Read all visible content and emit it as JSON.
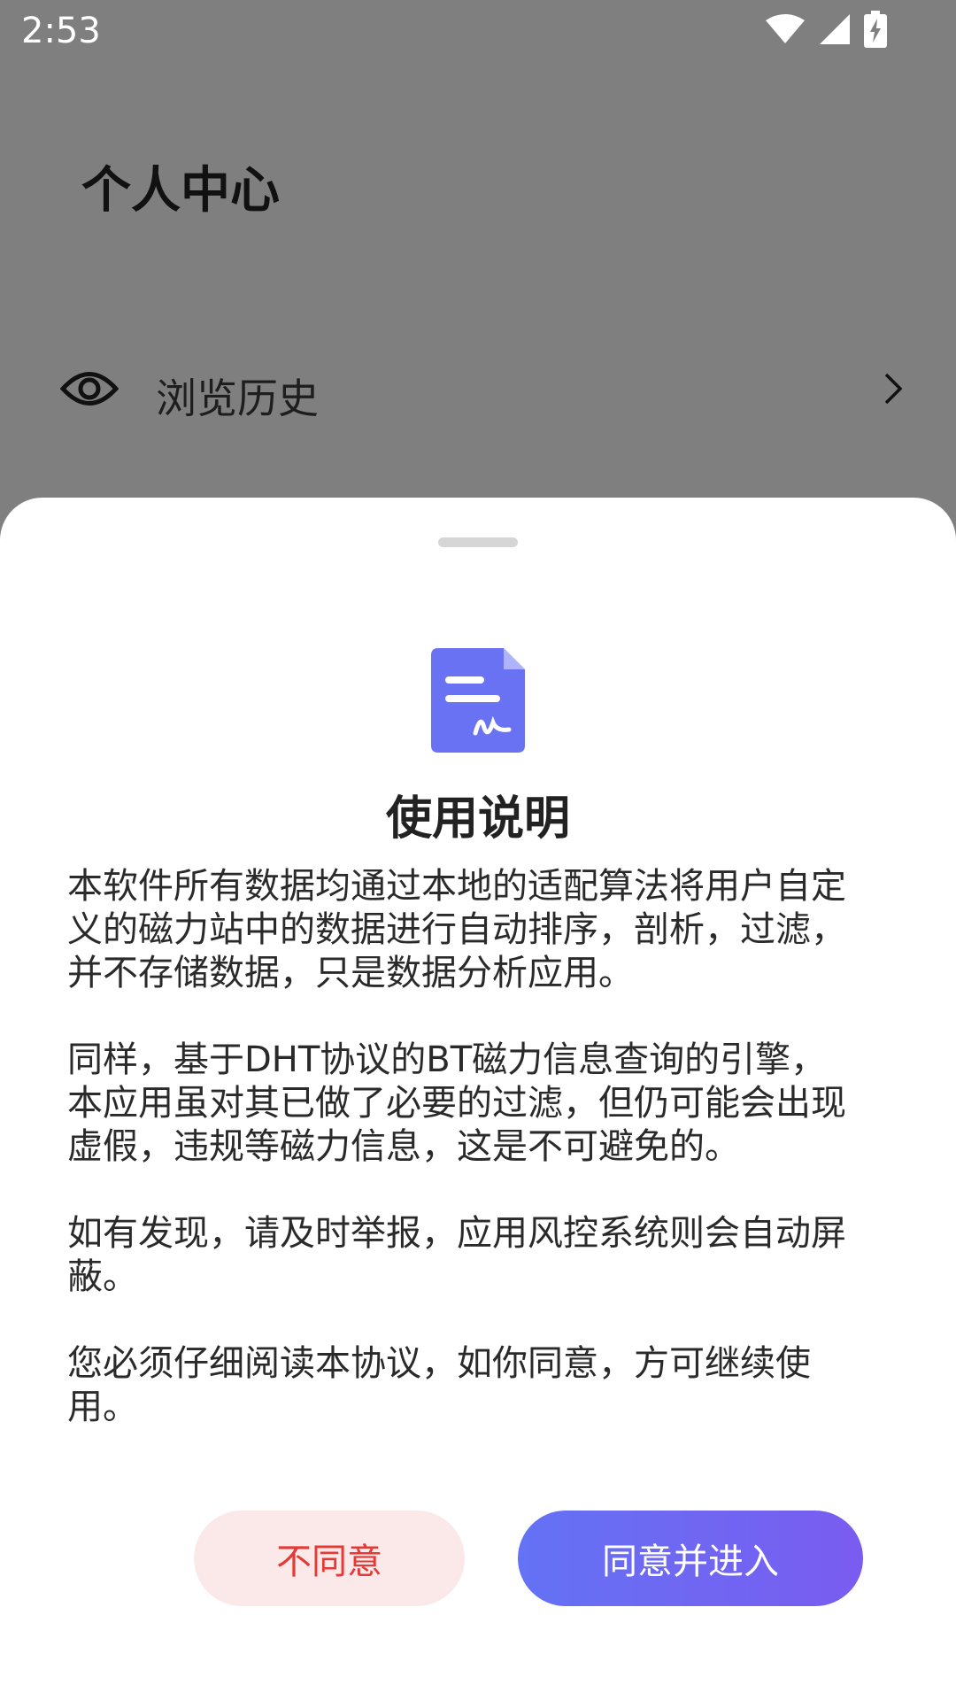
{
  "status_bar": {
    "time": "2:53",
    "icons": [
      "wifi-icon",
      "signal-icon",
      "battery-charging-icon"
    ]
  },
  "page": {
    "title": "个人中心",
    "items": [
      {
        "label": "浏览历史",
        "icon": "eye-icon",
        "trailing_icon": "chevron-right-icon"
      }
    ]
  },
  "dialog": {
    "icon": "document-signature-icon",
    "title": "使用说明",
    "paragraphs": [
      "本软件所有数据均通过本地的适配算法将用户自定\n义的磁力站中的数据进行自动排序，剖析，过滤，\n并不存储数据，只是数据分析应用。",
      "同样，基于DHT协议的BT磁力信息查询的引擎，\n本应用虽对其已做了必要的过滤，但仍可能会出现\n虚假，违规等磁力信息，这是不可避免的。",
      "如有发现，请及时举报，应用风控系统则会自动屏\n蔽。",
      "您必须仔细阅读本协议，如你同意，方可继续使\n用。"
    ],
    "disagree_label": "不同意",
    "agree_label": "同意并进入"
  },
  "colors": {
    "accent": "#6a6cf4",
    "danger": "#e53935",
    "danger_bg": "#fbe9e9",
    "scrim": "#7f7f7f"
  }
}
